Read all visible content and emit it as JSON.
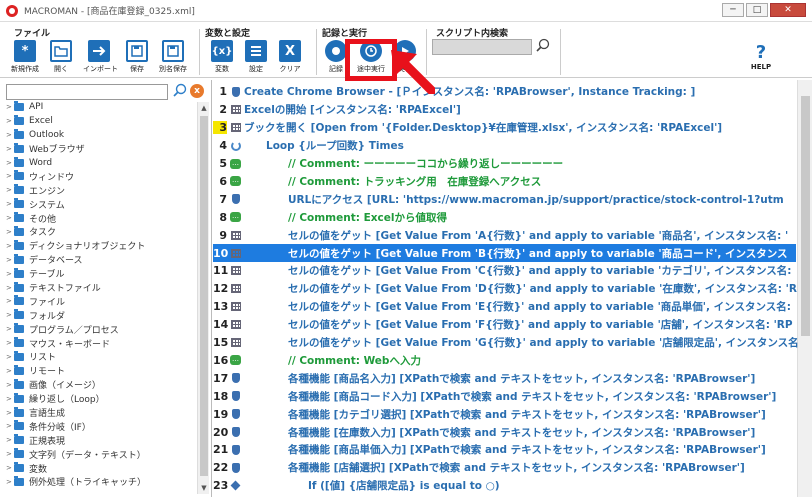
{
  "window": {
    "title": "MACROMAN - [商品在庫登録_0325.xml]",
    "minimize": "─",
    "maximize": "□",
    "close": "✕"
  },
  "ribbon": {
    "groups": {
      "file": "ファイル",
      "vars": "変数と設定",
      "rec": "記録と実行",
      "search": "スクリプト内検索"
    },
    "buttons": {
      "new": "新規作成",
      "open": "開く",
      "import": "インポート",
      "save": "保存",
      "saveas": "別名保存",
      "var": "変数",
      "settings": "設定",
      "clear": "クリア",
      "record": "記録",
      "run_from": "途中実行",
      "run": "実行",
      "help": "HELP"
    },
    "icons": {
      "new": "*",
      "var": "{x}",
      "clear": "X",
      "help": "?"
    }
  },
  "tree": {
    "clear_icon": "x",
    "items": [
      "API",
      "Excel",
      "Outlook",
      "Webブラウザ",
      "Word",
      "ウィンドウ",
      "エンジン",
      "システム",
      "その他",
      "タスク",
      "ディクショナリオブジェクト",
      "データベース",
      "テーブル",
      "テキストファイル",
      "ファイル",
      "フォルダ",
      "プログラム／プロセス",
      "マウス・キーボード",
      "リスト",
      "リモート",
      "画像（イメージ）",
      "繰り返し（Loop）",
      "言語生成",
      "条件分岐（IF）",
      "正規表現",
      "文字列（データ・テキスト）",
      "変数",
      "例外処理（トライキャッチ）"
    ]
  },
  "code": [
    {
      "n": "1",
      "icon": "hand",
      "indent": 0,
      "comment": false,
      "text": "Create Chrome Browser - [Ｐインスタンス名: 'RPABrowser', Instance Tracking: ]"
    },
    {
      "n": "2",
      "icon": "grid",
      "indent": 0,
      "comment": false,
      "text": "Excelの開始 [インスタンス名: 'RPAExcel']"
    },
    {
      "n": "3",
      "icon": "grid",
      "indent": 0,
      "comment": false,
      "text": "ブックを開く [Open from '{Folder.Desktop}¥在庫管理.xlsx', インスタンス名: 'RPAExcel']"
    },
    {
      "n": "4",
      "icon": "loop",
      "indent": 1,
      "comment": false,
      "text": "Loop {ループ回数} Times"
    },
    {
      "n": "5",
      "icon": "cmt",
      "indent": 2,
      "comment": true,
      "text": "// Comment: ーーーーーココから繰り返しーーーーーー"
    },
    {
      "n": "6",
      "icon": "cmt",
      "indent": 2,
      "comment": true,
      "text": "// Comment: トラッキング用　在庫登録へアクセス"
    },
    {
      "n": "7",
      "icon": "hand",
      "indent": 2,
      "comment": false,
      "text": "URLにアクセス [URL:  'https://www.macroman.jp/support/practice/stock-control-1?utm"
    },
    {
      "n": "8",
      "icon": "cmt",
      "indent": 2,
      "comment": true,
      "text": "// Comment: Excelから値取得"
    },
    {
      "n": "9",
      "icon": "grid",
      "indent": 2,
      "comment": false,
      "text": "セルの値をゲット [Get  Value From 'A{行数}' and apply to variable '商品名', インスタンス名: '"
    },
    {
      "n": "10",
      "icon": "grid",
      "indent": 2,
      "comment": false,
      "text": "セルの値をゲット [Get  Value From 'B{行数}' and apply to variable '商品コード', インスタンス"
    },
    {
      "n": "11",
      "icon": "grid",
      "indent": 2,
      "comment": false,
      "text": "セルの値をゲット [Get  Value From 'C{行数}' and apply to variable 'カテゴリ', インスタンス名:"
    },
    {
      "n": "12",
      "icon": "grid",
      "indent": 2,
      "comment": false,
      "text": "セルの値をゲット [Get  Value From 'D{行数}' and apply to variable '在庫数', インスタンス名: 'R"
    },
    {
      "n": "13",
      "icon": "grid",
      "indent": 2,
      "comment": false,
      "text": "セルの値をゲット [Get  Value From 'E{行数}' and apply to variable '商品単価', インスタンス名:"
    },
    {
      "n": "14",
      "icon": "grid",
      "indent": 2,
      "comment": false,
      "text": "セルの値をゲット [Get  Value From 'F{行数}' and apply to variable '店舗', インスタンス名: 'RP"
    },
    {
      "n": "15",
      "icon": "grid",
      "indent": 2,
      "comment": false,
      "text": "セルの値をゲット [Get  Value From 'G{行数}' and apply to variable '店舗限定品', インスタンス名"
    },
    {
      "n": "16",
      "icon": "cmt",
      "indent": 2,
      "comment": true,
      "text": "// Comment: Webへ入力"
    },
    {
      "n": "17",
      "icon": "hand",
      "indent": 2,
      "comment": false,
      "text": "各種機能 [商品名入力] [XPathで検索 and テキストをセット, インスタンス名: 'RPABrowser']"
    },
    {
      "n": "18",
      "icon": "hand",
      "indent": 2,
      "comment": false,
      "text": "各種機能 [商品コード入力] [XPathで検索 and テキストをセット, インスタンス名: 'RPABrowser']"
    },
    {
      "n": "19",
      "icon": "hand",
      "indent": 2,
      "comment": false,
      "text": "各種機能 [カテゴリ選択] [XPathで検索 and テキストをセット, インスタンス名: 'RPABrowser']"
    },
    {
      "n": "20",
      "icon": "hand",
      "indent": 2,
      "comment": false,
      "text": "各種機能 [在庫数入力] [XPathで検索 and テキストをセット, インスタンス名: 'RPABrowser']"
    },
    {
      "n": "21",
      "icon": "hand",
      "indent": 2,
      "comment": false,
      "text": "各種機能 [商品単価入力] [XPathで検索 and テキストをセット, インスタンス名: 'RPABrowser']"
    },
    {
      "n": "22",
      "icon": "hand",
      "indent": 2,
      "comment": false,
      "text": "各種機能 [店舗選択] [XPathで検索 and テキストをセット, インスタンス名: 'RPABrowser']"
    },
    {
      "n": "23",
      "icon": "diamond",
      "indent": 3,
      "comment": false,
      "text": "If ([値] {店舗限定品} is equal to ○)"
    }
  ],
  "state": {
    "selected_line": "10",
    "highlighted_line": "3"
  },
  "colors": {
    "accent": "#1f6fb8",
    "selection": "#1e7ce0",
    "comment": "#1e9a3a",
    "annotation": "#e8111b"
  }
}
